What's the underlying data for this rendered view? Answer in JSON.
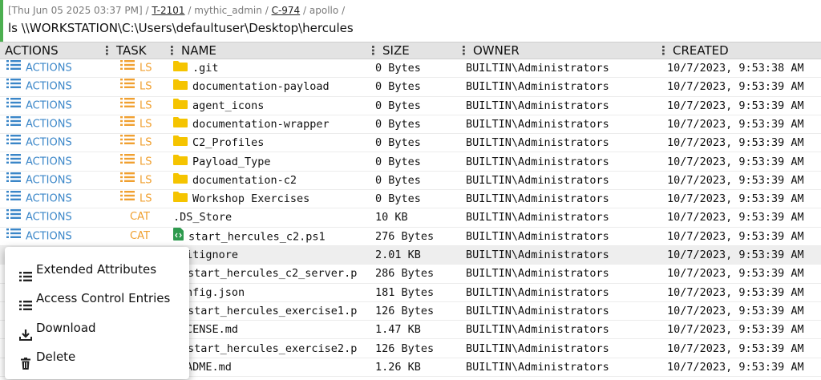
{
  "header": {
    "timestamp": "[Thu Jun 05 2025 03:37 PM]",
    "sep": "/",
    "task_id": "T-2101",
    "user": "mythic_admin",
    "callback_id": "C-974",
    "agent": "apollo",
    "command": "ls \\\\WORKSTATION\\C:\\Users\\defaultuser\\Desktop\\hercules"
  },
  "columns": {
    "actions": "ACTIONS",
    "task": "TASK",
    "name": "NAME",
    "size": "SIZE",
    "owner": "OWNER",
    "created": "CREATED"
  },
  "rows": [
    {
      "action": "ACTIONS",
      "task": "LS",
      "type": "folder",
      "name": ".git",
      "size": "0 Bytes",
      "owner": "BUILTIN\\Administrators",
      "created": "10/7/2023, 9:53:38 AM"
    },
    {
      "action": "ACTIONS",
      "task": "LS",
      "type": "folder",
      "name": "documentation-payload",
      "size": "0 Bytes",
      "owner": "BUILTIN\\Administrators",
      "created": "10/7/2023, 9:53:39 AM"
    },
    {
      "action": "ACTIONS",
      "task": "LS",
      "type": "folder",
      "name": "agent_icons",
      "size": "0 Bytes",
      "owner": "BUILTIN\\Administrators",
      "created": "10/7/2023, 9:53:39 AM"
    },
    {
      "action": "ACTIONS",
      "task": "LS",
      "type": "folder",
      "name": "documentation-wrapper",
      "size": "0 Bytes",
      "owner": "BUILTIN\\Administrators",
      "created": "10/7/2023, 9:53:39 AM"
    },
    {
      "action": "ACTIONS",
      "task": "LS",
      "type": "folder",
      "name": "C2_Profiles",
      "size": "0 Bytes",
      "owner": "BUILTIN\\Administrators",
      "created": "10/7/2023, 9:53:39 AM"
    },
    {
      "action": "ACTIONS",
      "task": "LS",
      "type": "folder",
      "name": "Payload_Type",
      "size": "0 Bytes",
      "owner": "BUILTIN\\Administrators",
      "created": "10/7/2023, 9:53:39 AM"
    },
    {
      "action": "ACTIONS",
      "task": "LS",
      "type": "folder",
      "name": "documentation-c2",
      "size": "0 Bytes",
      "owner": "BUILTIN\\Administrators",
      "created": "10/7/2023, 9:53:39 AM"
    },
    {
      "action": "ACTIONS",
      "task": "LS",
      "type": "folder",
      "name": "Workshop Exercises",
      "size": "0 Bytes",
      "owner": "BUILTIN\\Administrators",
      "created": "10/7/2023, 9:53:39 AM"
    },
    {
      "action": "ACTIONS",
      "task": "CAT",
      "type": "file",
      "name": ".DS_Store",
      "size": "10 KB",
      "owner": "BUILTIN\\Administrators",
      "created": "10/7/2023, 9:53:39 AM"
    },
    {
      "action": "ACTIONS",
      "task": "CAT",
      "type": "script",
      "name": "start_hercules_c2.ps1",
      "size": "276 Bytes",
      "owner": "BUILTIN\\Administrators",
      "created": "10/7/2023, 9:53:39 AM"
    },
    {
      "action": "",
      "task": "",
      "type": "file",
      "name": "itignore",
      "size": "2.01 KB",
      "owner": "BUILTIN\\Administrators",
      "created": "10/7/2023, 9:53:39 AM"
    },
    {
      "action": "",
      "task": "",
      "type": "file",
      "name": "start_hercules_c2_server.p",
      "size": "286 Bytes",
      "owner": "BUILTIN\\Administrators",
      "created": "10/7/2023, 9:53:39 AM"
    },
    {
      "action": "",
      "task": "",
      "type": "file",
      "name": "nfig.json",
      "size": "181 Bytes",
      "owner": "BUILTIN\\Administrators",
      "created": "10/7/2023, 9:53:39 AM"
    },
    {
      "action": "",
      "task": "",
      "type": "file",
      "name": "start_hercules_exercise1.p",
      "size": "126 Bytes",
      "owner": "BUILTIN\\Administrators",
      "created": "10/7/2023, 9:53:39 AM"
    },
    {
      "action": "",
      "task": "",
      "type": "file",
      "name": "CENSE.md",
      "size": "1.47 KB",
      "owner": "BUILTIN\\Administrators",
      "created": "10/7/2023, 9:53:39 AM"
    },
    {
      "action": "",
      "task": "",
      "type": "file",
      "name": "start_hercules_exercise2.p",
      "size": "126 Bytes",
      "owner": "BUILTIN\\Administrators",
      "created": "10/7/2023, 9:53:39 AM"
    },
    {
      "action": "",
      "task": "",
      "type": "file",
      "name": "ADME.md",
      "size": "1.26 KB",
      "owner": "BUILTIN\\Administrators",
      "created": "10/7/2023, 9:53:39 AM"
    }
  ],
  "context_menu": {
    "items": [
      {
        "label": "Extended Attributes",
        "icon": "list-icon"
      },
      {
        "label": "Access Control Entries",
        "icon": "list-icon"
      },
      {
        "label": "Download",
        "icon": "download-icon"
      },
      {
        "label": "Delete",
        "icon": "trash-icon"
      }
    ]
  },
  "colors": {
    "accent_green": "#4caf50",
    "action_blue": "#3a86c8",
    "task_orange": "#f0a030",
    "folder_yellow": "#f5c400",
    "script_green": "#2e9a4e"
  }
}
